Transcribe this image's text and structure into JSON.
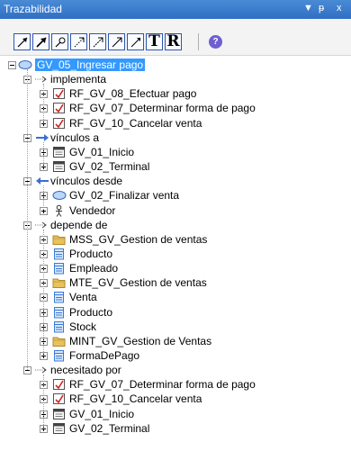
{
  "panel": {
    "title": "Trazabilidad",
    "menu_glyph": "▼",
    "pin_glyph": "ᵽ",
    "close_glyph": "x"
  },
  "toolbar": {
    "buttons": [
      {
        "icon": "arrow-ne-icon"
      },
      {
        "icon": "arrow-ne-bold-icon"
      },
      {
        "icon": "pen-icon"
      },
      {
        "icon": "dashed-arrow-icon"
      },
      {
        "icon": "dashed-arrow-alt-icon"
      },
      {
        "icon": "arrow-ne-thin-icon"
      },
      {
        "icon": "arrow-ne-plain-icon"
      },
      {
        "icon": "text-t-icon",
        "label": "T"
      },
      {
        "icon": "text-r-icon",
        "label": "R"
      }
    ],
    "help_label": "?"
  },
  "tree": {
    "root": "GV_05_Ingresar pago",
    "groups": [
      {
        "label": "implementa",
        "icon": "dotted-arrow-icon",
        "items": [
          {
            "label": "RF_GV_08_Efectuar pago",
            "icon": "requirement-icon"
          },
          {
            "label": "RF_GV_07_Determinar forma de pago",
            "icon": "requirement-icon"
          },
          {
            "label": "RF_GV_10_Cancelar venta",
            "icon": "requirement-icon"
          }
        ]
      },
      {
        "label": "vínculos a",
        "icon": "blue-arrow-right-icon",
        "items": [
          {
            "label": "GV_01_Inicio",
            "icon": "screen-icon"
          },
          {
            "label": "GV_02_Terminal",
            "icon": "screen-icon"
          }
        ]
      },
      {
        "label": "vínculos desde",
        "icon": "blue-arrow-left-icon",
        "items": [
          {
            "label": "GV_02_Finalizar venta",
            "icon": "usecase-icon"
          },
          {
            "label": "Vendedor",
            "icon": "actor-icon"
          }
        ]
      },
      {
        "label": "depende de",
        "icon": "dotted-arrow-icon",
        "items": [
          {
            "label": "MSS_GV_Gestion de ventas",
            "icon": "folder-icon"
          },
          {
            "label": "Producto",
            "icon": "class-icon"
          },
          {
            "label": "Empleado",
            "icon": "class-icon"
          },
          {
            "label": "MTE_GV_Gestion de ventas",
            "icon": "folder-icon"
          },
          {
            "label": "Venta",
            "icon": "class-icon"
          },
          {
            "label": "Producto",
            "icon": "class-icon"
          },
          {
            "label": "Stock",
            "icon": "class-icon"
          },
          {
            "label": "MINT_GV_Gestion de Ventas",
            "icon": "folder-icon"
          },
          {
            "label": "FormaDePago",
            "icon": "class-icon"
          }
        ]
      },
      {
        "label": "necesitado por",
        "icon": "dotted-arrow-icon",
        "items": [
          {
            "label": "RF_GV_07_Determinar forma de pago",
            "icon": "requirement-icon"
          },
          {
            "label": "RF_GV_10_Cancelar venta",
            "icon": "requirement-icon"
          },
          {
            "label": "GV_01_Inicio",
            "icon": "screen-icon"
          },
          {
            "label": "GV_02_Terminal",
            "icon": "screen-icon"
          }
        ]
      }
    ]
  },
  "colors": {
    "title_bar": "#2f6fc4",
    "selection": "#3399ff",
    "folder": "#e8c25a",
    "class": "#3a7bd5",
    "requirement": "#cc2222"
  }
}
